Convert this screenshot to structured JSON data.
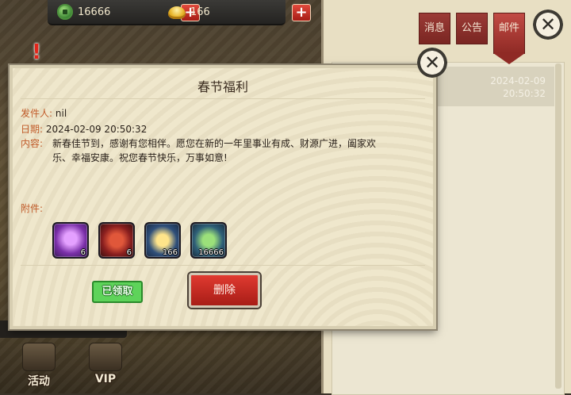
{
  "resources": {
    "jade": "16666",
    "gold": "166",
    "plus": "+"
  },
  "alert": "!",
  "mail_panel": {
    "tabs": [
      "消息",
      "公告",
      "邮件"
    ],
    "active_tab": "邮件",
    "mail_item": {
      "date": "2024-02-09",
      "time": "20:50:32"
    },
    "close": "✕"
  },
  "dialog": {
    "title": "春节福利",
    "from_label": "发件人:",
    "from_value": "nil",
    "date_label": "日期:",
    "date_value": "2024-02-09 20:50:32",
    "content_label": "内容:",
    "content_value": "新春佳节到，感谢有您相伴。愿您在新的一年里事业有成、财源广进，阖家欢乐、幸福安康。祝您春节快乐，万事如意!",
    "attachments_label": "附件:",
    "attachments": [
      {
        "icon": "scroll-icon",
        "count": "6"
      },
      {
        "icon": "firecracker-icon",
        "count": "6"
      },
      {
        "icon": "gold-ingot-icon",
        "count": "166"
      },
      {
        "icon": "jade-coin-icon",
        "count": "16666"
      }
    ],
    "claimed_label": "已领取",
    "delete_label": "删除",
    "close": "✕"
  },
  "bottom_bar": {
    "activity_label": "活动",
    "vip_label": "VIP"
  },
  "colors": {
    "accent_red": "#a81d17",
    "label_orange": "#c05a28",
    "parchment": "#efe7cc",
    "claimed_green": "#5ed35a"
  }
}
